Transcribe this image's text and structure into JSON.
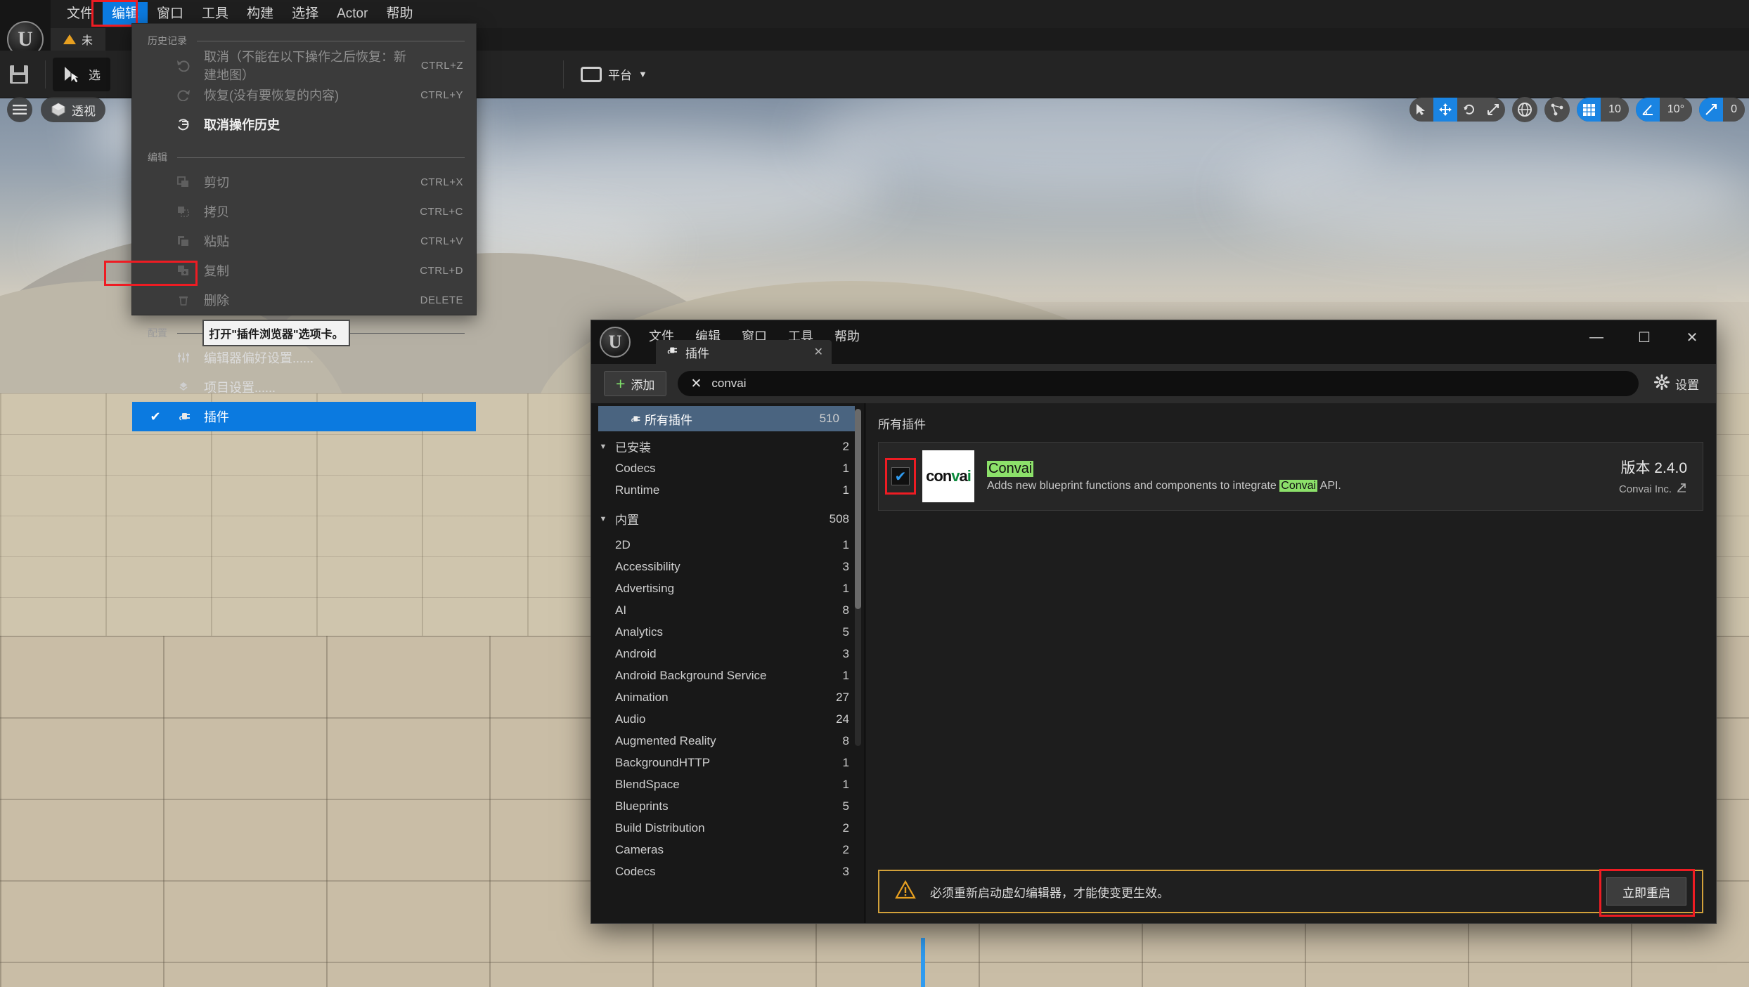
{
  "editor": {
    "menubar": [
      {
        "label": "文件",
        "active": false
      },
      {
        "label": "编辑",
        "active": true
      },
      {
        "label": "窗口",
        "active": false
      },
      {
        "label": "工具",
        "active": false
      },
      {
        "label": "构建",
        "active": false
      },
      {
        "label": "选择",
        "active": false
      },
      {
        "label": "Actor",
        "active": false
      },
      {
        "label": "帮助",
        "active": false
      }
    ],
    "tab_label": "未",
    "toolbar": {
      "save_label": "",
      "select_label": "选",
      "platform_label": "平台"
    },
    "viewport": {
      "menu_icon": "hamburger-icon",
      "perspective_label": "透视",
      "grid_snap_value": "10",
      "angle_snap_value": "10°",
      "scale_snap_value": "0"
    }
  },
  "edit_menu": {
    "section_history": "历史记录",
    "section_edit": "编辑",
    "section_config": "配置",
    "items_history": [
      {
        "label": "取消（不能在以下操作之后恢复：新建地图）",
        "shortcut": "CTRL+Z",
        "state": "dim",
        "icon": "undo-icon"
      },
      {
        "label": "恢复(没有要恢复的内容)",
        "shortcut": "CTRL+Y",
        "state": "dim",
        "icon": "redo-icon"
      },
      {
        "label": "取消操作历史",
        "shortcut": "",
        "state": "enabled",
        "icon": "history-icon"
      }
    ],
    "items_edit": [
      {
        "label": "剪切",
        "shortcut": "CTRL+X",
        "state": "dim",
        "icon": "cut-icon"
      },
      {
        "label": "拷贝",
        "shortcut": "CTRL+C",
        "state": "dim",
        "icon": "copy-icon"
      },
      {
        "label": "粘贴",
        "shortcut": "CTRL+V",
        "state": "dim",
        "icon": "paste-icon"
      },
      {
        "label": "复制",
        "shortcut": "CTRL+D",
        "state": "dim",
        "icon": "duplicate-icon"
      },
      {
        "label": "删除",
        "shortcut": "DELETE",
        "state": "dim",
        "icon": "trash-icon"
      }
    ],
    "items_config": [
      {
        "label": "编辑器偏好设置......",
        "shortcut": "",
        "state": "enabled",
        "icon": "sliders-icon",
        "checked": false
      },
      {
        "label": "项目设置......",
        "shortcut": "",
        "state": "enabled",
        "icon": "project-icon",
        "checked": false
      },
      {
        "label": "插件",
        "shortcut": "",
        "state": "selected",
        "icon": "plug-icon",
        "checked": true
      }
    ],
    "tooltip": "打开\"插件浏览器\"选项卡。"
  },
  "plugins_window": {
    "menus": [
      "文件",
      "编辑",
      "窗口",
      "工具",
      "帮助"
    ],
    "tab_label": "插件",
    "tab_close": "✕",
    "window_controls": {
      "minimize": "—",
      "maximize": "☐",
      "close": "✕"
    },
    "add_button": "添加",
    "search_value": "convai",
    "search_clear_icon": "x-icon",
    "settings_label": "设置",
    "left_panel": {
      "all_plugins": {
        "label": "所有插件",
        "count": "510"
      },
      "groups": [
        {
          "label": "已安装",
          "count": "2",
          "expanded": true,
          "children": [
            {
              "label": "Codecs",
              "count": "1"
            },
            {
              "label": "Runtime",
              "count": "1"
            }
          ]
        },
        {
          "label": "内置",
          "count": "508",
          "expanded": true,
          "children": [
            {
              "label": "2D",
              "count": "1"
            },
            {
              "label": "Accessibility",
              "count": "3"
            },
            {
              "label": "Advertising",
              "count": "1"
            },
            {
              "label": "AI",
              "count": "8"
            },
            {
              "label": "Analytics",
              "count": "5"
            },
            {
              "label": "Android",
              "count": "3"
            },
            {
              "label": "Android Background Service",
              "count": "1"
            },
            {
              "label": "Animation",
              "count": "27"
            },
            {
              "label": "Audio",
              "count": "24"
            },
            {
              "label": "Augmented Reality",
              "count": "8"
            },
            {
              "label": "BackgroundHTTP",
              "count": "1"
            },
            {
              "label": "BlendSpace",
              "count": "1"
            },
            {
              "label": "Blueprints",
              "count": "5"
            },
            {
              "label": "Build Distribution",
              "count": "2"
            },
            {
              "label": "Cameras",
              "count": "2"
            },
            {
              "label": "Codecs",
              "count": "3"
            }
          ]
        }
      ]
    },
    "right_panel": {
      "heading": "所有插件",
      "plugin": {
        "enabled": true,
        "thumb_text": "convai",
        "name": "Convai",
        "description_pre": "Adds new blueprint functions and components to integrate ",
        "description_highlight": "Convai",
        "description_post": " API.",
        "version_label": "版本 2.4.0",
        "vendor": "Convai Inc."
      }
    },
    "restart_bar": {
      "message": "必须重新启动虚幻编辑器，才能使变更生效。",
      "button": "立即重启",
      "warn_icon": "warning-triangle-icon"
    }
  },
  "colors": {
    "accent_blue": "#0b7ae0",
    "highlight_green": "#8ce06a",
    "annotation_red": "#ee1c23",
    "warning_amber": "#d2a13a"
  }
}
